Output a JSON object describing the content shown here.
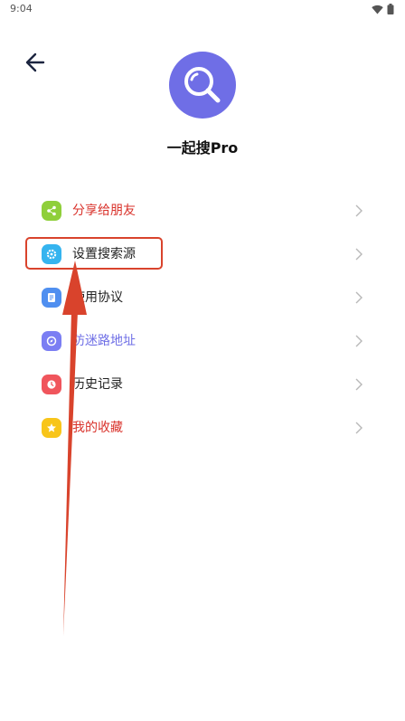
{
  "status": {
    "time": "9:04",
    "icons": [
      "wifi-icon",
      "battery-icon"
    ]
  },
  "header": {
    "back_icon": "arrow-left-icon",
    "logo_icon": "magnifier-icon",
    "app_name": "一起搜Pro"
  },
  "menu": {
    "items": [
      {
        "label": "分享给朋友",
        "icon": "share-icon",
        "icon_color": "#8fcf3a",
        "label_color": "#d9322b"
      },
      {
        "label": "设置搜索源",
        "icon": "settings-icon",
        "icon_color": "#35b4ef",
        "label_color": "#222222"
      },
      {
        "label": "使用协议",
        "icon": "document-icon",
        "icon_color": "#4f8ff0",
        "label_color": "#222222"
      },
      {
        "label": "防迷路地址",
        "icon": "compass-icon",
        "icon_color": "#7b7ef3",
        "label_color": "#6f6fe6"
      },
      {
        "label": "历史记录",
        "icon": "clock-icon",
        "icon_color": "#f0555c",
        "label_color": "#222222"
      },
      {
        "label": "我的收藏",
        "icon": "star-icon",
        "icon_color": "#f8c51a",
        "label_color": "#d9322b"
      }
    ]
  },
  "annotation": {
    "color": "#d9432c",
    "highlighted_item": "设置搜索源"
  }
}
